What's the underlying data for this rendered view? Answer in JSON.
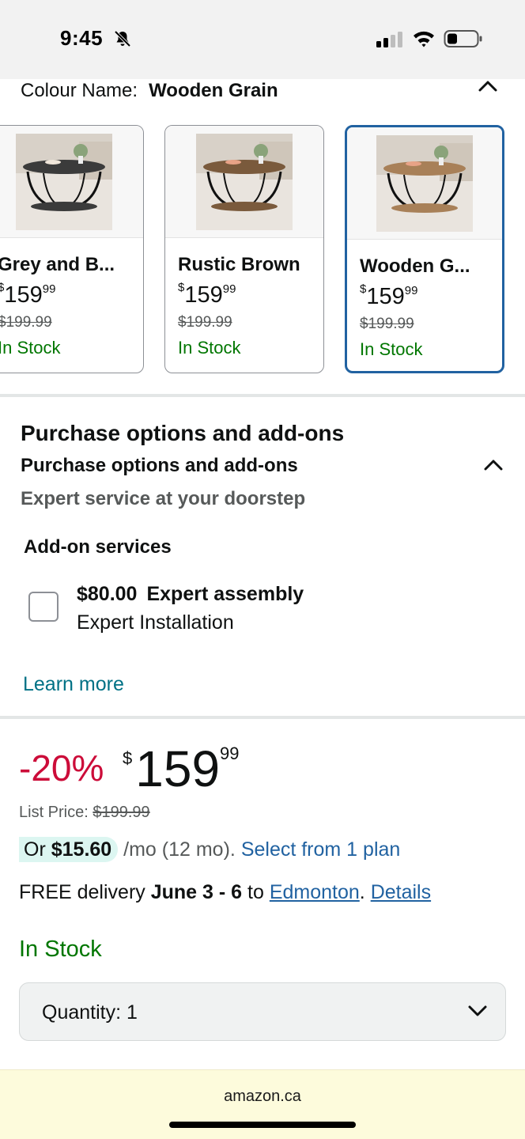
{
  "status_bar": {
    "time": "9:45",
    "icons": [
      "bell-slash-icon",
      "cellular-signal-icon",
      "wifi-icon",
      "battery-icon"
    ]
  },
  "colour": {
    "label": "Colour Name:",
    "value": "Wooden Grain"
  },
  "swatches": [
    {
      "name": "Grey and B...",
      "currency": "$",
      "whole": "159",
      "fraction": "99",
      "list_price": "$199.99",
      "stock": "In Stock"
    },
    {
      "name": "Rustic Brown",
      "currency": "$",
      "whole": "159",
      "fraction": "99",
      "list_price": "$199.99",
      "stock": "In Stock"
    },
    {
      "name": "Wooden G...",
      "currency": "$",
      "whole": "159",
      "fraction": "99",
      "list_price": "$199.99",
      "stock": "In Stock",
      "selected": true
    }
  ],
  "purchase_options": {
    "title": "Purchase options and add-ons",
    "subtitle": "Purchase options and add-ons",
    "tagline": "Expert service at your doorstep",
    "addon_heading": "Add-on services",
    "addon": {
      "price": "$80.00",
      "name": "Expert assembly",
      "description": "Expert Installation",
      "checked": false
    },
    "learn_more": "Learn more"
  },
  "price": {
    "discount": "-20%",
    "currency": "$",
    "whole": "159",
    "fraction": "99",
    "list_label": "List Price:",
    "list_value": "$199.99",
    "monthly_prefix": "Or",
    "monthly_amount": "$15.60",
    "monthly_suffix": "/mo (12 mo).",
    "monthly_link": "Select from 1 plan"
  },
  "delivery": {
    "prefix": "FREE delivery",
    "dates": "June 3 - 6",
    "to": "to",
    "city": "Edmonton",
    "period": ".",
    "details": "Details"
  },
  "availability": "In Stock",
  "quantity": {
    "label": "Quantity:",
    "value": "1"
  },
  "browser": {
    "url": "amazon.ca"
  },
  "colors": {
    "link": "#2162a1",
    "teal_link": "#007185",
    "stock_green": "#007600",
    "discount_red": "#cc0c39",
    "selected_border": "#2162a1"
  }
}
